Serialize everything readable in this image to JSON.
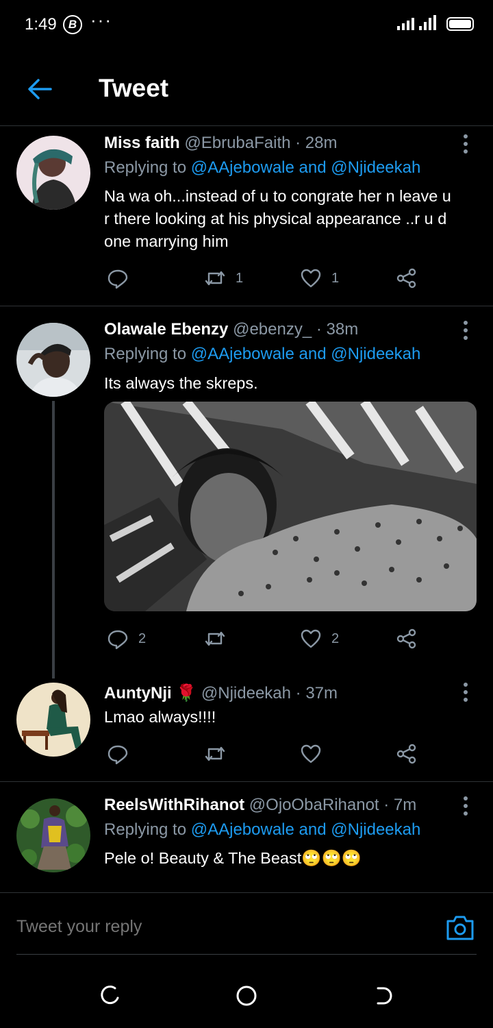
{
  "status_bar": {
    "time": "1:49",
    "badge": "B",
    "overflow": "···"
  },
  "header": {
    "title": "Tweet",
    "back_icon": "arrow-left-icon"
  },
  "tweets": [
    {
      "name": "Miss faith",
      "handle": "@EbrubaFaith · 28m",
      "replying_prefix": "Replying to",
      "replying_mentions": "@AAjebowale and @Njideekah",
      "text_lines": [
        "Na wa oh...instead of u to congrate her n leave u",
        "r there looking at his physical appearance ..r u d",
        "one marrying him"
      ],
      "reply_count": "",
      "retweet_count": "1",
      "like_count": "1"
    },
    {
      "name": "Olawale Ebenzy",
      "handle": "@ebenzy_ · 38m",
      "replying_prefix": "Replying to",
      "replying_mentions": "@AAjebowale and @Njideekah",
      "text": "Its always the skreps.",
      "reply_count": "2",
      "retweet_count": "",
      "like_count": "2"
    },
    {
      "name": "AuntyNji",
      "emoji": "🌹",
      "handle": "@Njideekah · 37m",
      "text": "Lmao always!!!!",
      "reply_count": "",
      "retweet_count": "",
      "like_count": ""
    },
    {
      "name": "ReelsWithRihanot",
      "handle": "@OjoObaRihanot · 7m",
      "replying_prefix": "Replying to",
      "replying_mentions": "@AAjebowale and @Njideekah",
      "text": "Pele o! Beauty & The Beast",
      "emoji_suffix": "🙄🙄🙄"
    }
  ],
  "reply_bar": {
    "placeholder": "Tweet your reply",
    "camera_icon": "camera-icon"
  },
  "colors": {
    "accent": "#1d9bf0",
    "muted": "#8b98a5",
    "background": "#000000",
    "divider": "#2f3336"
  }
}
